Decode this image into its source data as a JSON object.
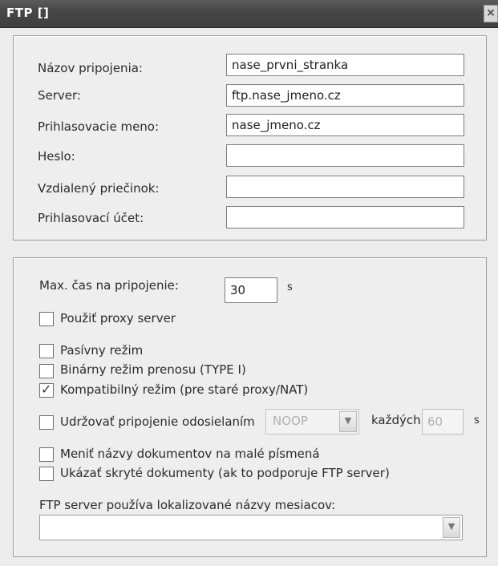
{
  "window": {
    "title": "FTP []",
    "close_glyph": "⨯"
  },
  "connection": {
    "name_label": "Názov pripojenia:",
    "name_value": "nase_prvni_stranka",
    "server_label": "Server:",
    "server_value": "ftp.nase_jmeno.cz",
    "login_label": "Prihlasovacie meno:",
    "login_value": "nase_jmeno.cz",
    "password_label": "Heslo:",
    "password_value": "",
    "remote_folder_label": "Vzdialený priečinok:",
    "remote_folder_value": "",
    "account_label": "Prihlasovací účet:",
    "account_value": ""
  },
  "options": {
    "timeout_label": "Max. čas na pripojenie:",
    "timeout_value": "30",
    "timeout_unit": "s",
    "use_proxy_label": "Použiť proxy server",
    "use_proxy_checked": false,
    "passive_label": "Pasívny režim",
    "passive_checked": false,
    "binary_label": "Binárny režim prenosu (TYPE I)",
    "binary_checked": false,
    "compat_label": "Kompatibilný režim (pre staré proxy/NAT)",
    "compat_checked": true,
    "keepalive_label": "Udržovať pripojenie odosielaním",
    "keepalive_checked": false,
    "keepalive_command": "NOOP",
    "keepalive_every_label": "každých",
    "keepalive_interval": "60",
    "keepalive_unit": "s",
    "lowercase_label": "Meniť názvy dokumentov na malé písmená",
    "lowercase_checked": false,
    "hidden_label": "Ukázať skryté dokumenty (ak to podporuje FTP server)",
    "hidden_checked": false,
    "months_label": "FTP server používa lokalizované názvy mesiacov:",
    "months_value": ""
  },
  "icons": {
    "checkbox_check": "check-icon",
    "dropdown_arrow": "chevron-down-icon",
    "close": "close-icon"
  }
}
